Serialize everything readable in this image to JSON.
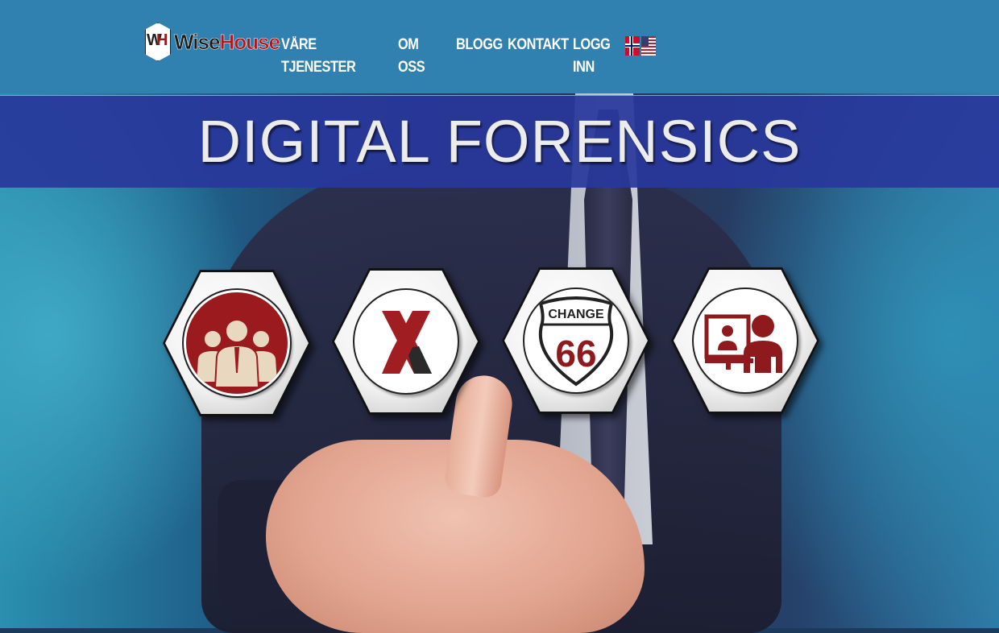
{
  "brand": {
    "logo_mark": "WH",
    "name_part1": "Wise",
    "name_part2": "House"
  },
  "nav": {
    "items": [
      {
        "label": "VÅRE TJENESTER"
      },
      {
        "label": "OM OSS"
      },
      {
        "label": "BLOGG"
      },
      {
        "label": "KONTAKT"
      },
      {
        "label": "LOGG INN"
      }
    ]
  },
  "languages": [
    {
      "name": "norwegian-flag-icon"
    },
    {
      "name": "us-flag-icon"
    }
  ],
  "hero": {
    "title": "DIGITAL FORENSICS"
  },
  "services": [
    {
      "icon": "team-people-icon"
    },
    {
      "icon": "x-logo-icon"
    },
    {
      "icon": "change-66-route-sign-icon",
      "sign_top": "CHANGE",
      "sign_number": "66"
    },
    {
      "icon": "video-meeting-icon"
    }
  ],
  "colors": {
    "header_bg": "#3181b0",
    "title_band": "#2837a0",
    "accent_red": "#9b1a1e"
  }
}
